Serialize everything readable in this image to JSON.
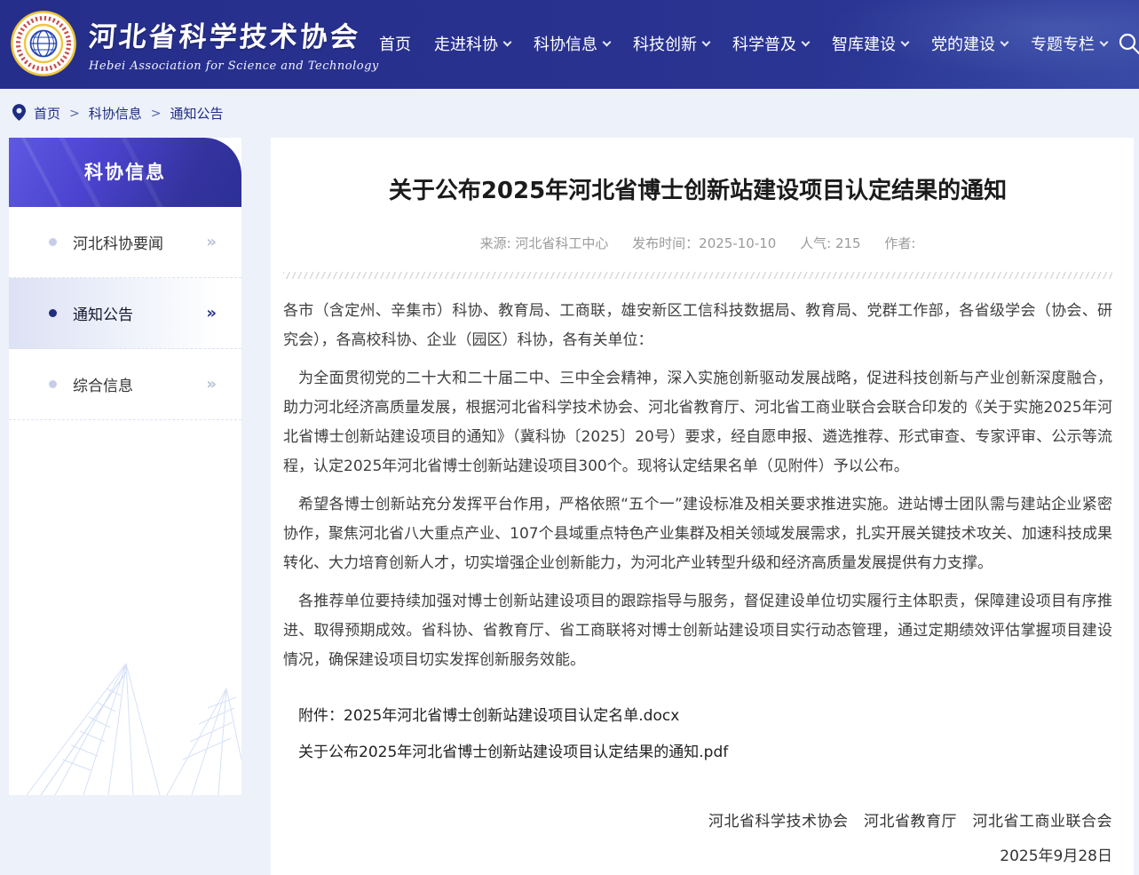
{
  "colors": {
    "header_blue": "#29328f",
    "accent_navy": "#1e2c85",
    "sidebar_gradient_from": "#5e58e2",
    "sidebar_gradient_to": "#2d2f99",
    "page_bg": "#edf1f9"
  },
  "header": {
    "site_name": "河北省科学技术协会",
    "site_name_en": "Hebei Association for Science and Technology",
    "nav": [
      {
        "label": "首页",
        "dropdown": false
      },
      {
        "label": "走进科协",
        "dropdown": true
      },
      {
        "label": "科协信息",
        "dropdown": true
      },
      {
        "label": "科技创新",
        "dropdown": true
      },
      {
        "label": "科学普及",
        "dropdown": true
      },
      {
        "label": "智库建设",
        "dropdown": true
      },
      {
        "label": "党的建设",
        "dropdown": true
      },
      {
        "label": "专题专栏",
        "dropdown": true
      }
    ]
  },
  "breadcrumb": {
    "separator": ">",
    "items": [
      "首页",
      "科协信息",
      "通知公告"
    ]
  },
  "sidebar": {
    "title": "科协信息",
    "chevron_glyph": "»",
    "items": [
      {
        "label": "河北科协要闻",
        "active": false
      },
      {
        "label": "通知公告",
        "active": true
      },
      {
        "label": "综合信息",
        "active": false
      }
    ]
  },
  "article": {
    "title": "关于公布2025年河北省博士创新站建设项目认定结果的通知",
    "meta_segments": [
      "来源: 河北省科工中心",
      "发布时间：2025-10-10",
      "人气: 215",
      "作者:"
    ],
    "paragraphs": [
      "各市（含定州、辛集市）科协、教育局、工商联，雄安新区工信科技数据局、教育局、党群工作部，各省级学会（协会、研究会），各高校科协、企业（园区）科协，各有关单位：",
      "为全面贯彻党的二十大和二十届二中、三中全会精神，深入实施创新驱动发展战略，促进科技创新与产业创新深度融合，助力河北经济高质量发展，根据河北省科学技术协会、河北省教育厅、河北省工商业联合会联合印发的《关于实施2025年河北省博士创新站建设项目的通知》（冀科协〔2025〕20号）要求，经自愿申报、遴选推荐、形式审查、专家评审、公示等流程，认定2025年河北省博士创新站建设项目300个。现将认定结果名单（见附件）予以公布。",
      "希望各博士创新站充分发挥平台作用，严格依照“五个一”建设标准及相关要求推进实施。进站博士团队需与建站企业紧密协作，聚焦河北省八大重点产业、107个县域重点特色产业集群及相关领域发展需求，扎实开展关键技术攻关、加速科技成果转化、大力培育创新人才，切实增强企业创新能力，为河北产业转型升级和经济高质量发展提供有力支撑。",
      "各推荐单位要持续加强对博士创新站建设项目的跟踪指导与服务，督促建设单位切实履行主体职责，保障建设项目有序推进、取得预期成效。省科协、省教育厅、省工商联将对博士创新站建设项目实行动态管理，通过定期绩效评估掌握项目建设情况，确保建设项目切实发挥创新服务效能。"
    ],
    "attachments": [
      "附件：2025年河北省博士创新站建设项目认定名单.docx",
      "关于公布2025年河北省博士创新站建设项目认定结果的通知.pdf"
    ],
    "signature": "河北省科学技术协会　河北省教育厅　河北省工商业联合会",
    "sign_date": "2025年9月28日"
  }
}
